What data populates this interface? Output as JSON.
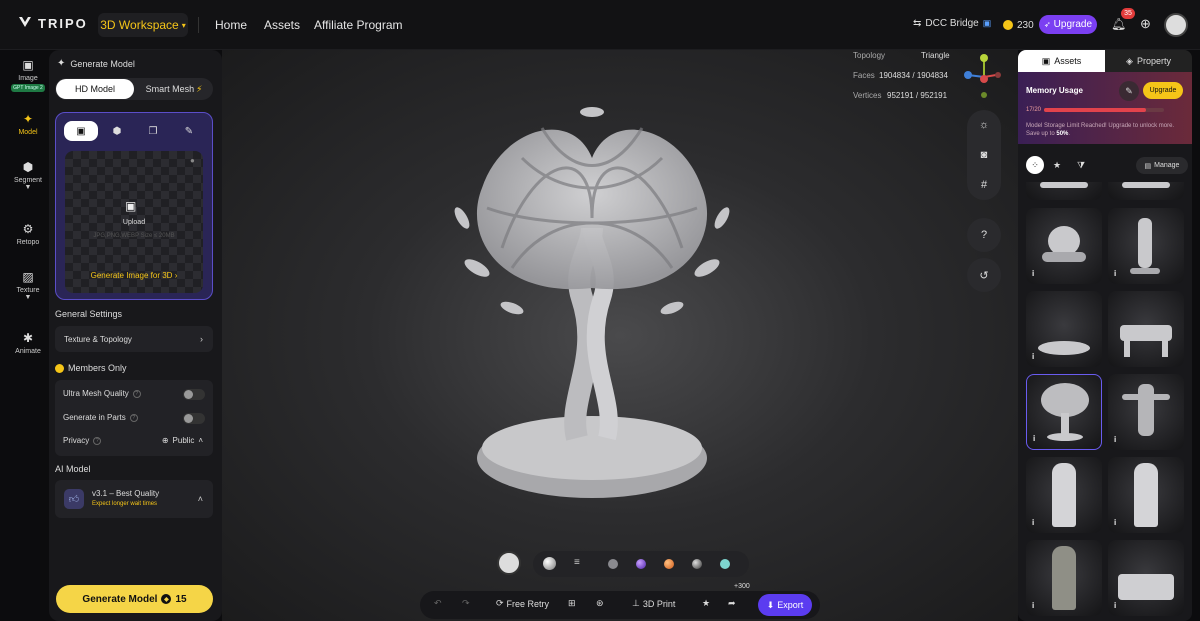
{
  "nav": {
    "brand": "TRIPO",
    "workspace": "3D Workspace",
    "links": [
      "Home",
      "Assets",
      "Affiliate Program"
    ],
    "dcc_bridge": "DCC Bridge",
    "credits": "230",
    "upgrade": "Upgrade",
    "notifications": "35"
  },
  "rail": {
    "items": [
      {
        "label": "Image",
        "badge": "GPT Image 2"
      },
      {
        "label": "Model"
      },
      {
        "label": "Segment"
      },
      {
        "label": "Retopo"
      },
      {
        "label": "Texture"
      },
      {
        "label": "Animate"
      }
    ]
  },
  "left": {
    "title": "Generate Model",
    "hd_model": "HD Model",
    "smart_mesh": "Smart Mesh",
    "upload_label": "Upload",
    "upload_formats": "JPG,PNG,WEBP Size ≤ 20MB",
    "generate_image": "Generate Image for 3D",
    "general_settings": "General Settings",
    "texture_topology": "Texture & Topology",
    "members_only": "Members Only",
    "ultra_mesh": "Ultra Mesh Quality",
    "generate_parts": "Generate in Parts",
    "privacy": "Privacy",
    "privacy_value": "Public",
    "ai_model": "AI Model",
    "ai_model_name": "v3.1 – Best Quality",
    "ai_model_note": "Expect longer wait times",
    "generate_button": "Generate Model",
    "generate_cost": "15"
  },
  "viewport": {
    "topology_label": "Topology",
    "topology_value": "Triangle",
    "faces_label": "Faces",
    "faces_value": "1904834 / 1904834",
    "vertices_label": "Vertices",
    "vertices_value": "952191 / 952191",
    "free_retry": "Free Retry",
    "print_3d": "3D Print",
    "export": "Export",
    "plus_credits": "+300"
  },
  "right": {
    "tab_assets": "Assets",
    "tab_property": "Property",
    "memory_title": "Memory Usage",
    "memory_count": "17/20",
    "memory_fraction": 0.85,
    "memory_upgrade": "Upgrade",
    "memory_msg_a": "Model Storage Limit Reached! Upgrade to unlock more. Save up to ",
    "memory_msg_b": "50%",
    "memory_msg_c": ".",
    "manage": "Manage"
  },
  "colors": {
    "accent": "#f5c518",
    "brand_purple": "#5b3cf0",
    "panel": "#18181b"
  }
}
